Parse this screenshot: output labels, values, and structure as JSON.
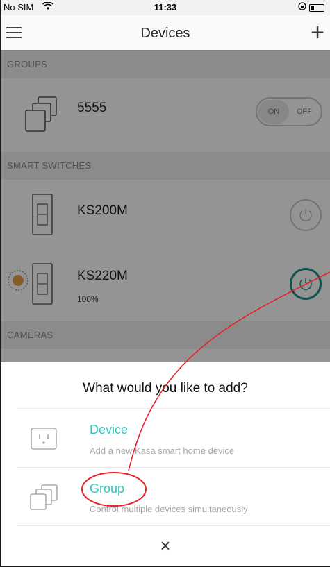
{
  "status_bar": {
    "carrier": "No SIM",
    "wifi": "wifi-icon",
    "time": "11:33"
  },
  "nav": {
    "title": "Devices"
  },
  "groups": {
    "header": "GROUPS",
    "items": [
      {
        "name": "5555",
        "on_label": "ON",
        "off_label": "OFF"
      }
    ]
  },
  "smart_switches": {
    "header": "SMART SWITCHES",
    "items": [
      {
        "name": "KS200M"
      },
      {
        "name": "KS220M",
        "brightness": "100%"
      }
    ]
  },
  "cameras": {
    "header": "CAMERAS"
  },
  "sheet": {
    "question": "What would you like to add?",
    "options": [
      {
        "label": "Device",
        "description": "Add a new Kasa smart home device"
      },
      {
        "label": "Group",
        "description": "Control multiple devices simultaneously"
      }
    ],
    "close_symbol": "×"
  },
  "colors": {
    "accent": "#2ec7c0",
    "annotation": "#e8212b",
    "power_active": "#1a8f86"
  }
}
